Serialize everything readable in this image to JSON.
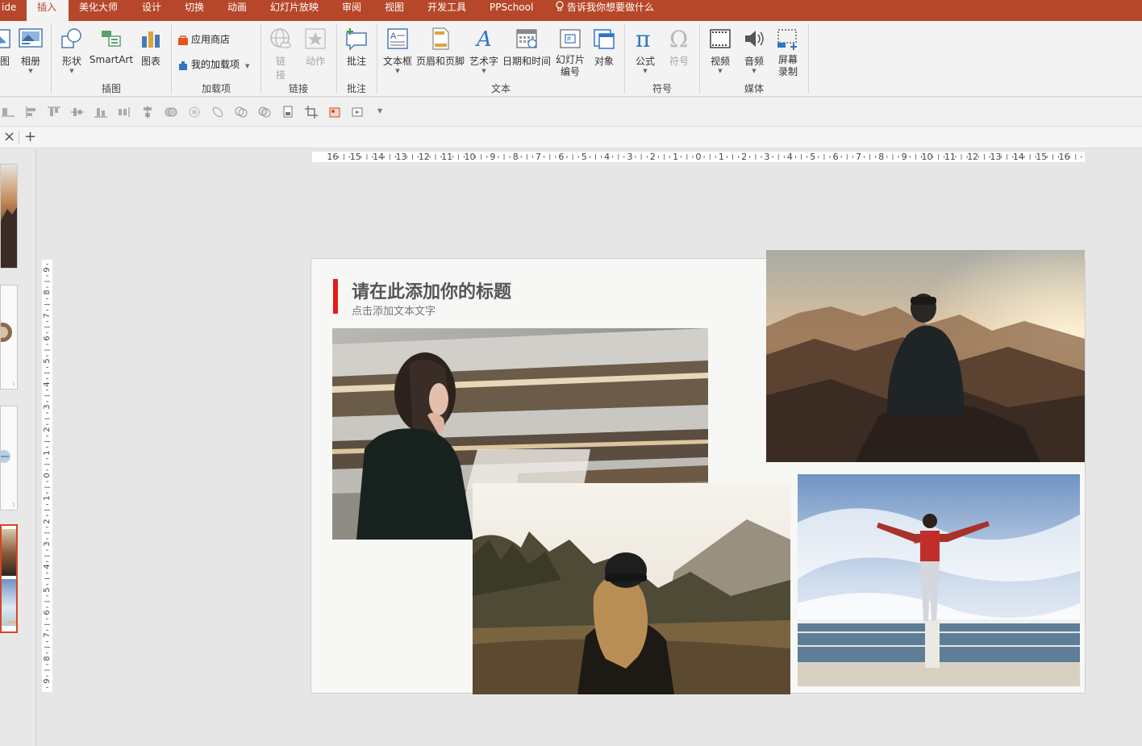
{
  "ribbon_tabs": [
    {
      "label": "ide",
      "active": false
    },
    {
      "label": "插入",
      "active": true
    },
    {
      "label": "美化大师",
      "active": false
    },
    {
      "label": "设计",
      "active": false
    },
    {
      "label": "切换",
      "active": false
    },
    {
      "label": "动画",
      "active": false
    },
    {
      "label": "幻灯片放映",
      "active": false
    },
    {
      "label": "审阅",
      "active": false
    },
    {
      "label": "视图",
      "active": false
    },
    {
      "label": "开发工具",
      "active": false
    },
    {
      "label": "PPSchool",
      "active": false
    }
  ],
  "tell_me": "告诉我你想要做什么",
  "ribbon": {
    "illustrations": {
      "pic_label": "图",
      "album_label": "相册",
      "shape_label": "形状",
      "smartart_label": "SmartArt",
      "chart_label": "图表",
      "group": "插图"
    },
    "addins": {
      "store_label": "应用商店",
      "my_addins_label": "我的加载项",
      "group": "加载项"
    },
    "links": {
      "link_label": "链\n接",
      "link_label_1": "链",
      "link_label_2": "接",
      "action_label": "动作",
      "group": "链接"
    },
    "comments": {
      "comment_label": "批注",
      "group": "批注"
    },
    "text": {
      "textbox_label": "文本框",
      "header_footer_label": "页眉和页脚",
      "wordart_label": "艺术字",
      "datetime_label": "日期和时间",
      "slide_number_label_1": "幻灯片",
      "slide_number_label_2": "编号",
      "object_label": "对象",
      "group": "文本"
    },
    "symbols": {
      "equation_label": "公式",
      "symbol_label": "符号",
      "group": "符号"
    },
    "media": {
      "video_label": "视频",
      "audio_label": "音频",
      "screen_label_1": "屏幕",
      "screen_label_2": "录制",
      "group": "媒体"
    }
  },
  "strip": {
    "close_glyph": "×",
    "add_glyph": "+"
  },
  "ruler": {
    "h_ticks": [
      "16",
      "15",
      "14",
      "13",
      "12",
      "11",
      "10",
      "9",
      "8",
      "7",
      "6",
      "5",
      "4",
      "3",
      "2",
      "1",
      "0",
      "1",
      "2",
      "3",
      "4",
      "5",
      "6",
      "7",
      "8",
      "9",
      "10",
      "11",
      "12",
      "13",
      "14",
      "15",
      "16"
    ],
    "v_ticks": [
      "9",
      "8",
      "7",
      "6",
      "5",
      "4",
      "3",
      "2",
      "1",
      "0",
      "1",
      "2",
      "3",
      "4",
      "5",
      "6",
      "7",
      "8",
      "9"
    ]
  },
  "slide": {
    "title": "请在此添加你的标题",
    "subtitle": "点击添加文本文字",
    "accent_color": "#e31b1b"
  },
  "colors": {
    "ribbon_tab_bg": "#b7472a",
    "accent": "#d24726"
  }
}
